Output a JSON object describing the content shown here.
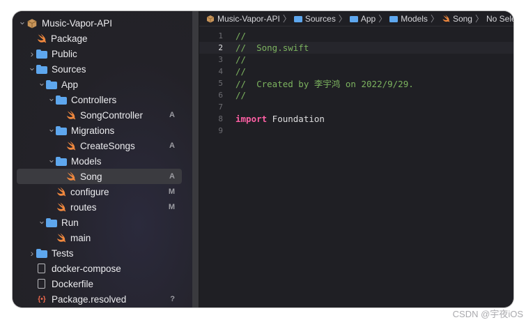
{
  "navigator": {
    "items": [
      {
        "label": "Music-Vapor-API",
        "icon": "package-icon",
        "depth": 0,
        "chevron": "down",
        "badge": ""
      },
      {
        "label": "Package",
        "icon": "swift-icon",
        "depth": 1,
        "chevron": "",
        "badge": ""
      },
      {
        "label": "Public",
        "icon": "folder-icon",
        "depth": 1,
        "chevron": "right",
        "badge": ""
      },
      {
        "label": "Sources",
        "icon": "folder-icon",
        "depth": 1,
        "chevron": "down",
        "badge": ""
      },
      {
        "label": "App",
        "icon": "folder-icon",
        "depth": 2,
        "chevron": "down",
        "badge": ""
      },
      {
        "label": "Controllers",
        "icon": "folder-icon",
        "depth": 3,
        "chevron": "down",
        "badge": ""
      },
      {
        "label": "SongController",
        "icon": "swift-icon",
        "depth": 4,
        "chevron": "",
        "badge": "A"
      },
      {
        "label": "Migrations",
        "icon": "folder-icon",
        "depth": 3,
        "chevron": "down",
        "badge": ""
      },
      {
        "label": "CreateSongs",
        "icon": "swift-icon",
        "depth": 4,
        "chevron": "",
        "badge": "A"
      },
      {
        "label": "Models",
        "icon": "folder-icon",
        "depth": 3,
        "chevron": "down",
        "badge": ""
      },
      {
        "label": "Song",
        "icon": "swift-icon",
        "depth": 4,
        "chevron": "",
        "badge": "A",
        "selected": true
      },
      {
        "label": "configure",
        "icon": "swift-icon",
        "depth": 3,
        "chevron": "",
        "badge": "M"
      },
      {
        "label": "routes",
        "icon": "swift-icon",
        "depth": 3,
        "chevron": "",
        "badge": "M"
      },
      {
        "label": "Run",
        "icon": "folder-icon",
        "depth": 2,
        "chevron": "down",
        "badge": ""
      },
      {
        "label": "main",
        "icon": "swift-icon",
        "depth": 3,
        "chevron": "",
        "badge": ""
      },
      {
        "label": "Tests",
        "icon": "folder-icon",
        "depth": 1,
        "chevron": "right",
        "badge": ""
      },
      {
        "label": "docker-compose",
        "icon": "doc-icon",
        "depth": 1,
        "chevron": "",
        "badge": ""
      },
      {
        "label": "Dockerfile",
        "icon": "doc-icon",
        "depth": 1,
        "chevron": "",
        "badge": ""
      },
      {
        "label": "Package.resolved",
        "icon": "resolved-icon",
        "depth": 1,
        "chevron": "",
        "badge": "?"
      }
    ]
  },
  "jumpbar": {
    "project": "Music-Vapor-API",
    "sources": "Sources",
    "app": "App",
    "models": "Models",
    "file": "Song",
    "selection": "No Selection"
  },
  "editor": {
    "current_line": 2,
    "lines": [
      {
        "n": "1",
        "text": "//"
      },
      {
        "n": "2",
        "text": "//  Song.swift"
      },
      {
        "n": "3",
        "text": "//"
      },
      {
        "n": "4",
        "text": "//"
      },
      {
        "n": "5",
        "text": "//  Created by 李宇鸿 on 2022/9/29."
      },
      {
        "n": "6",
        "text": "//"
      },
      {
        "n": "7",
        "text": ""
      },
      {
        "n": "8",
        "keyword": "import",
        "text": " Foundation"
      },
      {
        "n": "9",
        "text": ""
      }
    ]
  },
  "watermark": "CSDN @宇夜iOS",
  "colors": {
    "folder": "#5ea7ee",
    "swift": "#f0883e",
    "comment": "#7cb35f",
    "keyword": "#fc5fa3"
  }
}
